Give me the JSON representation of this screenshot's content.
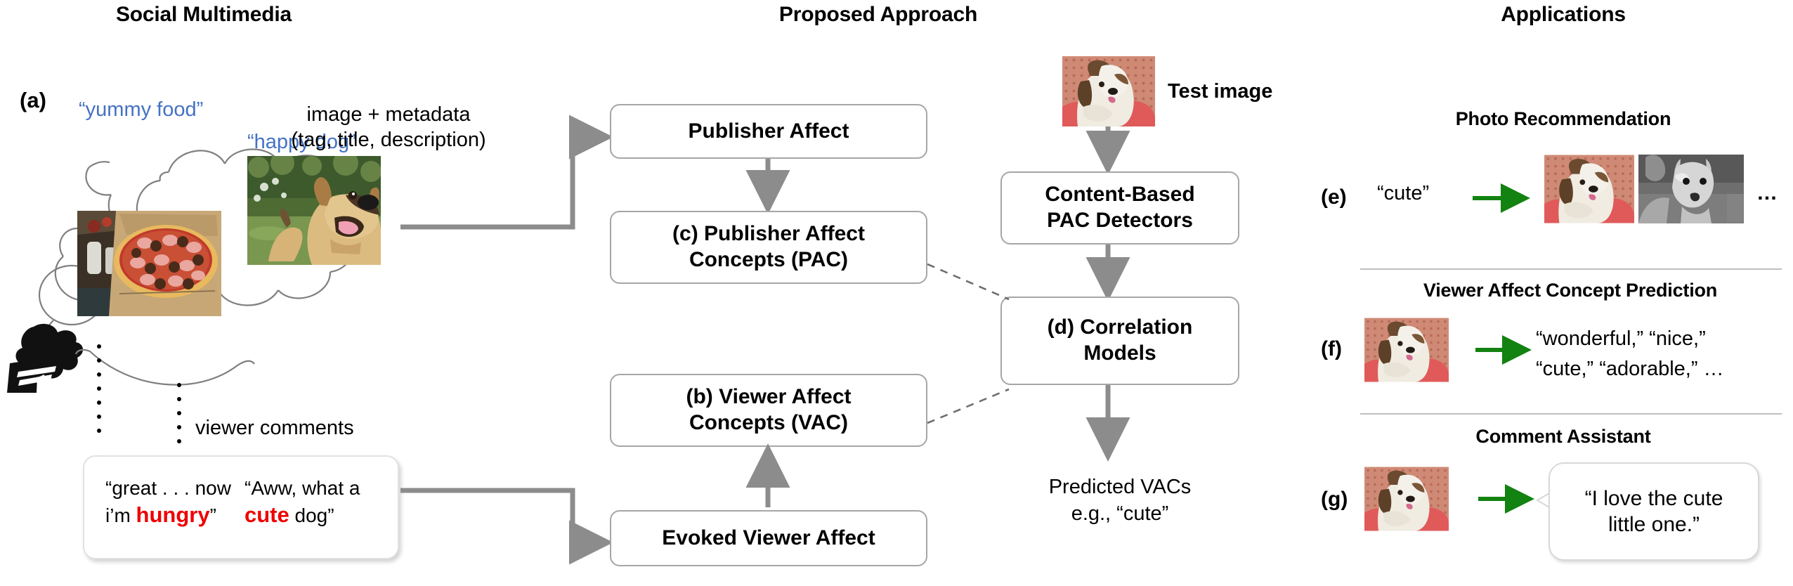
{
  "columns": {
    "social": "Social Multimedia",
    "approach": "Proposed Approach",
    "applications": "Applications"
  },
  "social": {
    "label_a": "(a)",
    "metadata_line1": "image + metadata",
    "metadata_line2": "(tag, title, description)",
    "tag_food": "“yummy food”",
    "tag_dog": "“happy dog”",
    "viewer_comments_label": "viewer comments",
    "comments": {
      "left_line1": "“great . . . now",
      "left_line2_pre": "i’m ",
      "left_line2_red": "hungry",
      "left_line2_post": "”",
      "right_line1": "“Aww, what a",
      "right_line2_red": "cute",
      "right_line2_post": " dog”"
    }
  },
  "approach": {
    "publisher_affect": "Publisher Affect",
    "pac_line1": "(c) Publisher Affect",
    "pac_line2": "Concepts (PAC)",
    "vac_line1": "(b) Viewer Affect",
    "vac_line2": "Concepts (VAC)",
    "evoked_viewer_affect": "Evoked Viewer Affect",
    "test_image_label": "Test image",
    "detectors_line1": "Content-Based",
    "detectors_line2": "PAC Detectors",
    "correlation_line1": "(d) Correlation",
    "correlation_line2": "Models",
    "predicted_line1": "Predicted VACs",
    "predicted_line2": "e.g., “cute”"
  },
  "applications": {
    "photo_rec": {
      "heading": "Photo Recommendation",
      "label": "(e)",
      "query": "“cute”",
      "ellipsis": "…"
    },
    "vac_prediction": {
      "heading": "Viewer Affect Concept Prediction",
      "label": "(f)",
      "result_line1": "“wonderful,” “nice,”",
      "result_line2": "“cute,” “adorable,” …"
    },
    "comment_assistant": {
      "heading": "Comment Assistant",
      "label": "(g)",
      "balloon_line1": "“I love the cute",
      "balloon_line2": "little one.”"
    }
  },
  "colors": {
    "tag_blue": "#4472C4",
    "highlight_red": "#EE0000",
    "arrow_gray": "#8c8c8c",
    "arrow_green": "#128210",
    "box_border": "#A6A6A6"
  },
  "icons": {
    "pizza": "pizza-photo",
    "dog": "happy-dog-photo",
    "puppy": "shih-tzu-puppy-photo",
    "terrier": "grayscale-terrier-photo",
    "person": "person-silhouette-icon",
    "thought_cloud": "thought-cloud-icon"
  }
}
